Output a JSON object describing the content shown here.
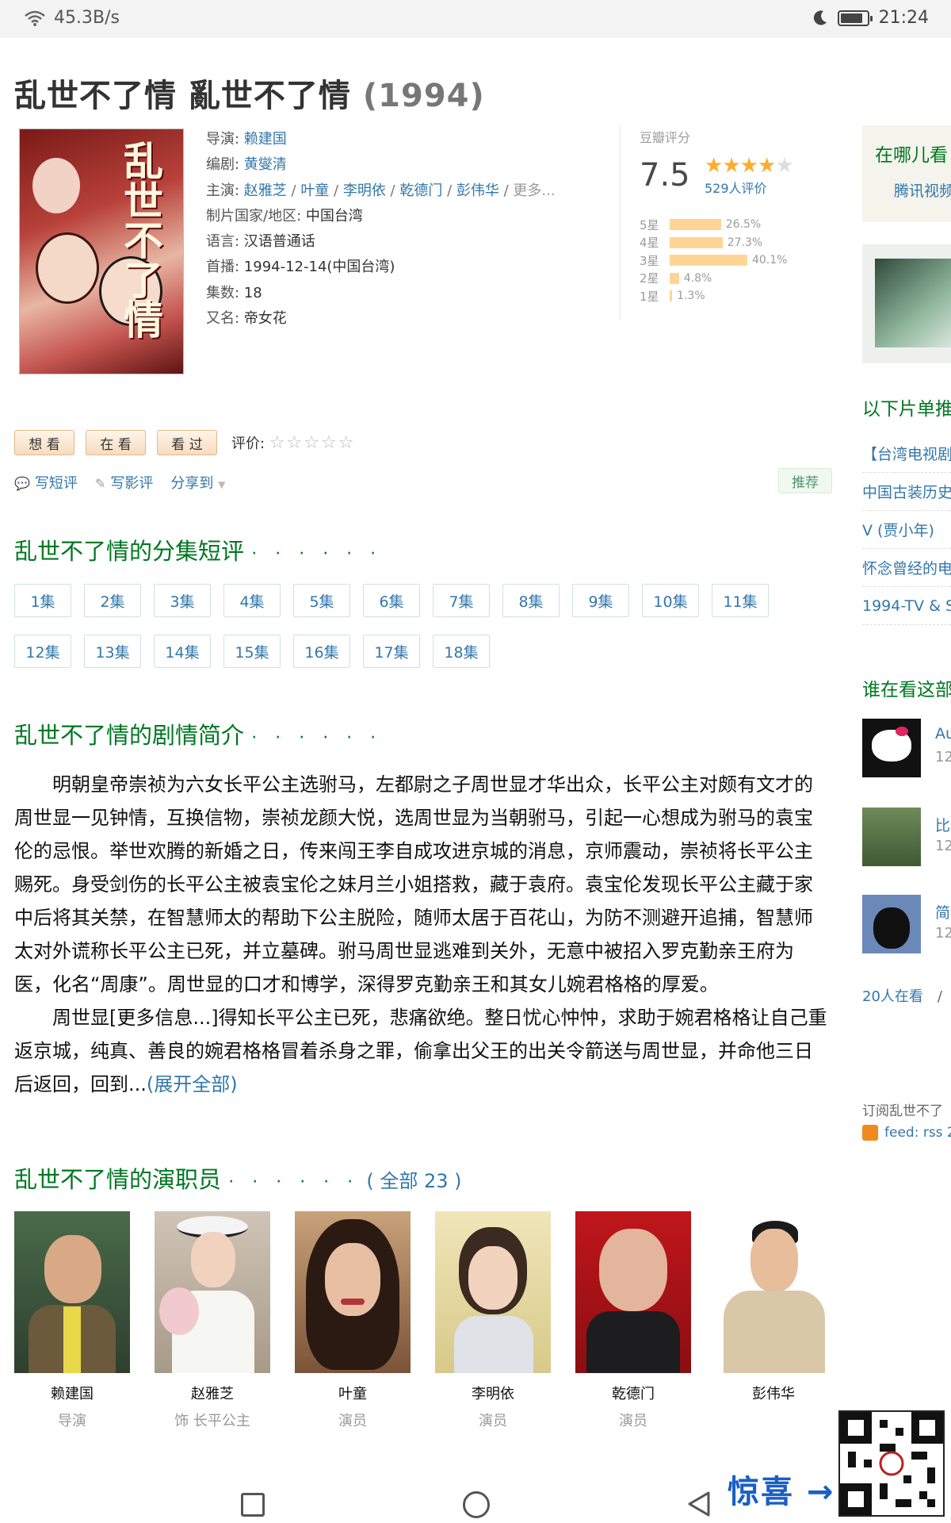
{
  "status_bar": {
    "speed": "45.3B/s",
    "time": "21:24",
    "battery_level": 0.85
  },
  "title": {
    "main": "乱世不了情 亂世不了情",
    "year": "(1994)"
  },
  "poster": {
    "title_text": "乱世不了情"
  },
  "info": {
    "director_label": "导演",
    "director": "赖建国",
    "writer_label": "编剧",
    "writer": "黄燮清",
    "cast_label": "主演",
    "cast": [
      "赵雅芝",
      "叶童",
      "李明依",
      "乾德门",
      "彭伟华"
    ],
    "cast_more": "更多...",
    "country_label": "制片国家/地区",
    "country": "中国台湾",
    "language_label": "语言",
    "language": "汉语普通话",
    "premiere_label": "首播",
    "premiere": "1994-12-14(中国台湾)",
    "episodes_label": "集数",
    "episodes": "18",
    "aka_label": "又名",
    "aka": "帝女花"
  },
  "rating": {
    "label": "豆瓣评分",
    "score": "7.5",
    "stars": 4,
    "votes": "529人评价",
    "distribution": [
      {
        "label": "5星",
        "percent": 26.5,
        "text": "26.5%"
      },
      {
        "label": "4星",
        "percent": 27.3,
        "text": "27.3%"
      },
      {
        "label": "3星",
        "percent": 40.1,
        "text": "40.1%"
      },
      {
        "label": "2星",
        "percent": 4.8,
        "text": "4.8%"
      },
      {
        "label": "1星",
        "percent": 1.3,
        "text": "1.3%"
      }
    ]
  },
  "actions": {
    "want": "想 看",
    "watching": "在 看",
    "watched": "看 过",
    "rate_label": "评价:",
    "rate_stars": "☆☆☆☆☆",
    "write_short": "写短评",
    "write_review": "写影评",
    "share": "分享到",
    "share_arrow": "▼",
    "recommend": "推荐"
  },
  "sections": {
    "episodes_title": "乱世不了情的分集短评",
    "summary_title": "乱世不了情的剧情简介",
    "cast_title": "乱世不了情的演职员",
    "dots": "· · · · · ·",
    "cast_all": "( 全部 23 )"
  },
  "episode_list": [
    "1集",
    "2集",
    "3集",
    "4集",
    "5集",
    "6集",
    "7集",
    "8集",
    "9集",
    "10集",
    "11集",
    "12集",
    "13集",
    "14集",
    "15集",
    "16集",
    "17集",
    "18集"
  ],
  "summary": {
    "p1": "明朝皇帝崇祯为六女长平公主选驸马，左都尉之子周世显才华出众，长平公主对颇有文才的周世显一见钟情，互换信物，崇祯龙颜大悦，选周世显为当朝驸马，引起一心想成为驸马的袁宝伦的忌恨。举世欢腾的新婚之日，传来闯王李自成攻进京城的消息，京师震动，崇祯将长平公主赐死。身受剑伤的长平公主被袁宝伦之妹月兰小姐搭救，藏于袁府。袁宝伦发现长平公主藏于家中后将其关禁，在智慧师太的帮助下公主脱险，随师太居于百花山，为防不测避开追捕，智慧师太对外谎称长平公主已死，并立墓碑。驸马周世显逃难到关外，无意中被招入罗克勤亲王府为医，化名“周康”。周世显的口才和博学，深得罗克勤亲王和其女儿婉君格格的厚爱。",
    "p2": "周世显[更多信息...]得知长平公主已死，悲痛欲绝。整日忧心忡忡，求助于婉君格格让自己重返京城，纯真、善良的婉君格格冒着杀身之罪，偷拿出父王的出关令箭送与周世显，并命他三日后返回，回到...",
    "expand": "(展开全部)"
  },
  "cast_members": [
    {
      "name": "赖建国",
      "role": "导演"
    },
    {
      "name": "赵雅芝",
      "role": "饰 长平公主"
    },
    {
      "name": "叶童",
      "role": "演员"
    },
    {
      "name": "李明依",
      "role": "演员"
    },
    {
      "name": "乾德门",
      "role": "演员"
    },
    {
      "name": "彭伟华",
      "role": ""
    }
  ],
  "sidebar": {
    "where_title": "在哪儿看",
    "where_source": "腾讯视频",
    "doulist_title": "以下片单推",
    "doulists": [
      "【台湾电视剧",
      "中国古装历史",
      "V (贾小年)",
      "怀念曾经的电",
      "1994-TV & S"
    ],
    "watchers_title": "谁在看这部",
    "watchers": [
      {
        "name": "Au",
        "sub": "12"
      },
      {
        "name": "比",
        "sub": "12"
      },
      {
        "name": "简",
        "sub": "12"
      }
    ],
    "watching_count": "20人在看",
    "watching_sep": "/",
    "subscribe": "订阅乱世不了",
    "feed": "feed: rss 2"
  },
  "overlay": {
    "surprise": "惊喜 →"
  },
  "colors": {
    "accent_green": "#007722",
    "link_blue": "#3377aa",
    "star_orange": "#ffac2d",
    "bar_yellow": "#ffd596"
  }
}
